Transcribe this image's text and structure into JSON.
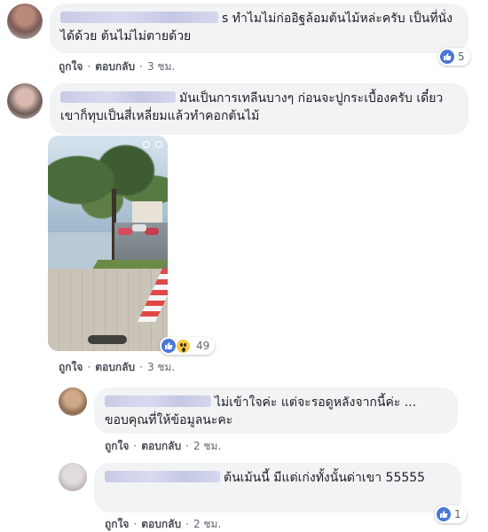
{
  "comments": [
    {
      "text": "s ทำไมไม่ก่ออิฐล้อมต้นไม้หล่ะครับ เป็นที่นั่งได้ด้วย ต้นไม่ไม่ตายด้วย",
      "actions": {
        "like": "ถูกใจ",
        "reply": "ตอบกลับ",
        "time": "3 ชม."
      },
      "reaction_count": "5"
    },
    {
      "text": "มันเป็นการเทลีนบางๆ ก่อนจะปูกระเบื้องครับ เดี๋ยวเขาก็ทุบเป็นสี่เหลี่ยมแล้วทำคอกต้นไม้",
      "actions": {
        "like": "ถูกใจ",
        "reply": "ตอบกลับ",
        "time": "3 ชม."
      },
      "reaction_count": "49"
    }
  ],
  "replies": [
    {
      "text": "ไม่เข้าใจค่ะ แต่จะรอดูหลังจากนี้ค่ะ ... ขอบคุณที่ให้ข้อมูลนะคะ",
      "actions": {
        "like": "ถูกใจ",
        "reply": "ตอบกลับ",
        "time": "2 ชม."
      }
    },
    {
      "text": "ต้นเม้นนี้ มีแต่เก่งทั้งนั้นด่าเขา 55555",
      "actions": {
        "like": "ถูกใจ",
        "reply": "ตอบกลับ",
        "time": "2 ชม."
      },
      "reaction_count": "1"
    }
  ],
  "separator": "·",
  "icons": {
    "like": "like-icon",
    "wow": "wow-icon"
  },
  "colors": {
    "like_blue": "#4a77d8",
    "bubble_bg": "#f2f3f5",
    "name_blur": "#c9cbe6"
  }
}
